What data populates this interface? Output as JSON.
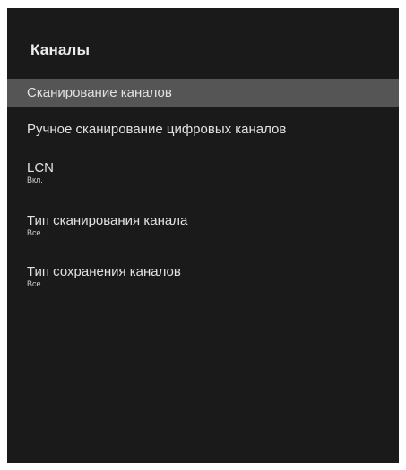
{
  "panel": {
    "title": "Каналы",
    "items": [
      {
        "label": "Сканирование каналов",
        "value": null,
        "selected": true
      },
      {
        "label": "Ручное сканирование цифровых каналов",
        "value": null,
        "selected": false
      },
      {
        "label": "LCN",
        "value": "Вкл.",
        "selected": false
      },
      {
        "label": "Тип сканирования канала",
        "value": "Все",
        "selected": false
      },
      {
        "label": "Тип сохранения каналов",
        "value": "Все",
        "selected": false
      }
    ]
  },
  "colors": {
    "panel_background": "#1a1a1a",
    "selected_highlight": "#555555",
    "text": "#e2e2e2"
  }
}
